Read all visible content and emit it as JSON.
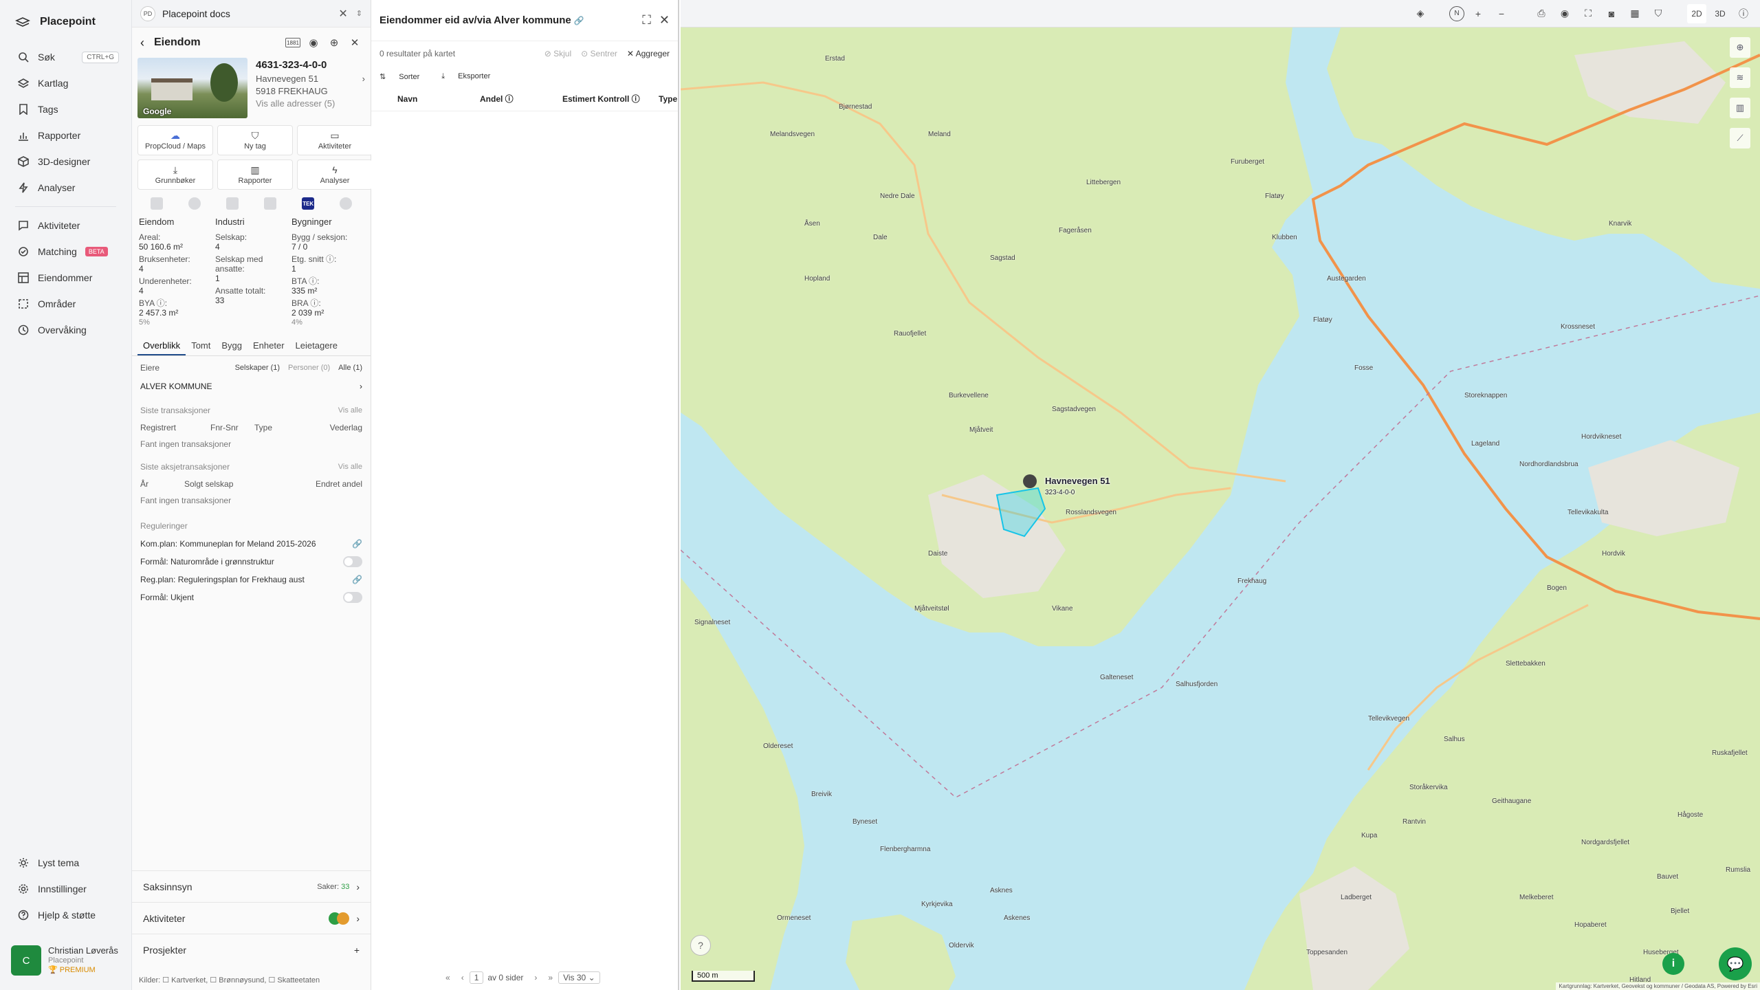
{
  "nav": {
    "brand": "Placepoint",
    "items": [
      {
        "label": "Søk",
        "kbd": "CTRL+G",
        "icon": "search-icon"
      },
      {
        "label": "Kartlag",
        "icon": "layers-icon"
      },
      {
        "label": "Tags",
        "icon": "bookmark-icon"
      },
      {
        "label": "Rapporter",
        "icon": "chart-icon"
      },
      {
        "label": "3D-designer",
        "icon": "cube-icon"
      },
      {
        "label": "Analyser",
        "icon": "bolt-icon"
      }
    ],
    "items2": [
      {
        "label": "Aktiviteter",
        "icon": "chat-icon"
      },
      {
        "label": "Matching",
        "badge": "BETA",
        "icon": "matching-icon"
      },
      {
        "label": "Eiendommer",
        "icon": "grid-icon"
      },
      {
        "label": "Områder",
        "icon": "area-icon"
      },
      {
        "label": "Overvåking",
        "icon": "clock-icon"
      }
    ],
    "bottom": [
      {
        "label": "Lyst tema",
        "icon": "sun-icon"
      },
      {
        "label": "Innstillinger",
        "icon": "gear-icon"
      },
      {
        "label": "Hjelp & støtte",
        "icon": "help-icon"
      }
    ],
    "user": {
      "initial": "C",
      "name": "Christian Løverås",
      "org": "Placepoint",
      "plan": "PREMIUM"
    }
  },
  "doc": {
    "badge": "PD",
    "title": "Placepoint docs"
  },
  "property": {
    "header": "Eiendom",
    "badge": "1881",
    "id": "4631-323-4-0-0",
    "address": "Havnevegen 51",
    "postal": "5918 FREKHAUG",
    "all_addresses": "Vis alle adresser (5)",
    "photo_credit": "Google",
    "actions": [
      {
        "label": "PropCloud / Maps",
        "icon": "☁"
      },
      {
        "label": "Ny tag",
        "icon": "⛉"
      },
      {
        "label": "Aktiviteter",
        "icon": "▭"
      },
      {
        "label": "Grunnbøker",
        "icon": "⤓"
      },
      {
        "label": "Rapporter",
        "icon": "▥"
      },
      {
        "label": "Analyser",
        "icon": "ϟ"
      }
    ],
    "source_tek": "TEK",
    "stats": {
      "col1": {
        "head": "Eiendom",
        "areal_l": "Areal:",
        "areal": "50 160.6 m²",
        "bruk_l": "Bruksenheter:",
        "bruk": "4",
        "under_l": "Underenheter:",
        "under": "4",
        "bya_l": "BYA ⓘ:",
        "bya": "2 457.3 m²",
        "bya_p": "5%"
      },
      "col2": {
        "head": "Industri",
        "sel_l": "Selskap:",
        "sel": "4",
        "selans_l": "Selskap med ansatte:",
        "selans": "1",
        "ans_l": "Ansatte totalt:",
        "ans": "33"
      },
      "col3": {
        "head": "Bygninger",
        "bygg_l": "Bygg / seksjon:",
        "bygg": "7 / 0",
        "etg_l": "Etg. snitt ⓘ:",
        "etg": "1",
        "bta_l": "BTA ⓘ:",
        "bta": "335 m²",
        "bra_l": "BRA ⓘ:",
        "bra": "2 039 m²",
        "bra_p": "4%"
      }
    },
    "tabs": [
      "Overblikk",
      "Tomt",
      "Bygg",
      "Enheter",
      "Leietagere"
    ],
    "owners": {
      "label": "Eiere",
      "f1": "Selskaper (1)",
      "f2": "Personer (0)",
      "f3": "Alle (1)",
      "name": "ALVER KOMMUNE"
    },
    "tx": {
      "title": "Siste transaksjoner",
      "show": "Vis alle",
      "cols": [
        "Registrert",
        "Fnr-Snr",
        "Type",
        "Vederlag"
      ],
      "empty": "Fant ingen transaksjoner"
    },
    "stx": {
      "title": "Siste aksjetransaksjoner",
      "show": "Vis alle",
      "cols": [
        "År",
        "Solgt selskap",
        "Endret andel"
      ],
      "empty": "Fant ingen transaksjoner"
    },
    "reg": {
      "title": "Reguleringer",
      "r1": "Kom.plan: Kommuneplan for Meland 2015-2026",
      "r2": "Formål: Naturområde i grønnstruktur",
      "r3": "Reg.plan: Reguleringsplan for Frekhaug aust",
      "r4": "Formål: Ukjent"
    },
    "bottom": {
      "saks": "Saksinnsyn",
      "saker_l": "Saker:",
      "saker": "33",
      "akt": "Aktiviteter",
      "prosj": "Prosjekter"
    },
    "sources": "Kilder: ☐ Kartverket, ☐ Brønnøysund, ☐ Skatteetaten"
  },
  "results": {
    "title": "Eiendommer eid av/via Alver kommune",
    "count": "0 resultater på kartet",
    "hide": "Skjul",
    "center": "Sentrer",
    "aggregate": "Aggreger",
    "sort": "Sorter",
    "export": "Eksporter",
    "cols": [
      "Navn",
      "Andel ⓘ",
      "Estimert Kontroll ⓘ",
      "Type"
    ],
    "page": "1",
    "of_pages": "av 0 sider",
    "per_page": "Vis 30"
  },
  "map": {
    "pin_label": "Havnevegen 51",
    "pin_id": "323-4-0-0",
    "scale": "500 m",
    "attribution": "Kartgrunnlag: Kartverket, Geovekst og kommuner / Geodata AS, Powered by Esri",
    "view_2d": "2D",
    "view_3d": "3D",
    "places": [
      "Erstad",
      "Melandsvegen",
      "Meland",
      "Bjørnestad",
      "Nedre Dale",
      "Åsen",
      "Dale",
      "Hopland",
      "Rauofjellet",
      "Sagstad",
      "Fageråsen",
      "Littebergen",
      "Furuberget",
      "Flatøy",
      "Austegarden",
      "Klubben",
      "Knarvik",
      "Krossneset",
      "Flatøy",
      "Fosse",
      "Storeknappen",
      "Sagstadvegen",
      "Lageland",
      "Mjåtveit",
      "Burkevellene",
      "Rosslandsvegen",
      "Frekhaug",
      "Daiste",
      "Mjåtveitstøl",
      "Vikane",
      "Galteneset",
      "Salhusfjorden",
      "Hordvikneset",
      "Tellevikakulta",
      "Hordvik",
      "Bogen",
      "Nordhordlandsbrua",
      "Signalneset",
      "Oldereset",
      "Breivik",
      "Byneset",
      "Flenbergharmna",
      "Kyrkjevika",
      "Asknes",
      "Oldervik",
      "Askenes",
      "Ormeneset",
      "Salhus",
      "Tellevikvegen",
      "Slettebakken",
      "Rantvin",
      "Kupa",
      "Ladberget",
      "Storåkervika",
      "Geithaugane",
      "Nordgardsfjellet",
      "Melkeberet",
      "Hopaberet",
      "Bauvet",
      "Bjellet",
      "Huseberget",
      "Hitland",
      "Toppesanden",
      "Rumslia",
      "Ruskafjellet",
      "Hågoste"
    ]
  },
  "colors": {
    "accent": "#1aa04a",
    "land": "#dcebb9",
    "water": "#bfe7f1",
    "road": "#f2934a"
  }
}
